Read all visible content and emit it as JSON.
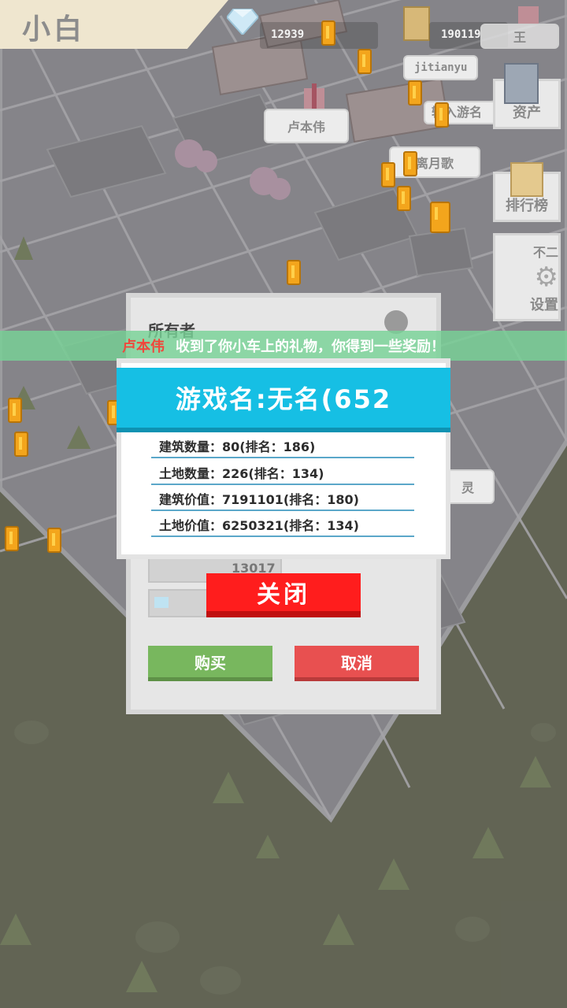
{
  "header": {
    "title": "小白",
    "diamonds": "12939",
    "coins": "190119",
    "rank_name": "王",
    "player_tag": "jitianyu"
  },
  "side_menu": {
    "assets_label": "资产",
    "leaderboard_label": "排行榜",
    "settings_label": "设置",
    "settings_top_text": "不二"
  },
  "map_bubbles": [
    "卢本伟",
    "输入游名",
    "离月歌",
    "灵"
  ],
  "notice": {
    "sender": "卢本伟",
    "message": "收到了你小车上的礼物，你得到一些奖励！"
  },
  "owner_panel": {
    "owner_label": "所有者",
    "price_value": "13017",
    "buy_label": "购买",
    "cancel_label": "取消"
  },
  "info_dialog": {
    "title": "游戏名:无名(652",
    "rows": [
      "建筑数量：80(排名：186)",
      "土地数量：226(排名：134)",
      "建筑价值：7191101(排名：180)",
      "土地价值：6250321(排名：134)"
    ],
    "close_label": "关闭"
  },
  "colors": {
    "info_header": "#16bfe4",
    "close_button": "#ff1d1d",
    "buy_button": "#78b75e",
    "cancel_button": "#e85050",
    "notice_bar": "#78d296",
    "notice_sender": "#f0473c"
  }
}
